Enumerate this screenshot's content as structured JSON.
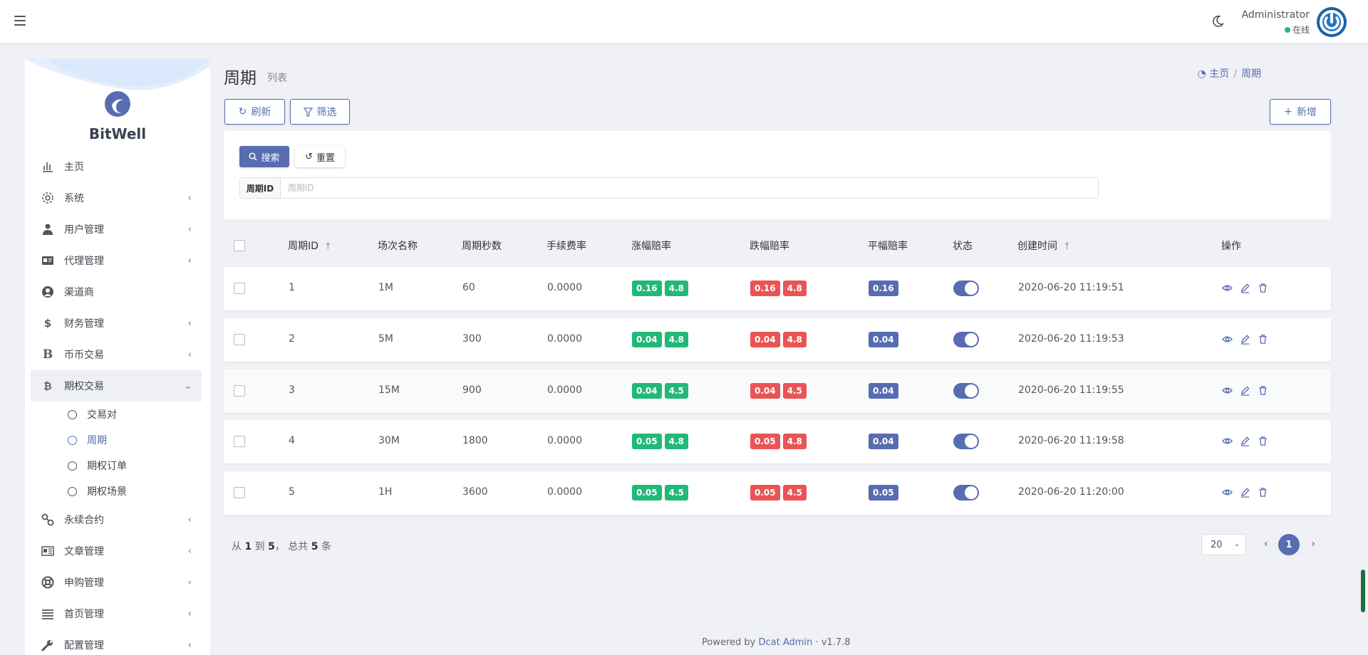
{
  "header": {
    "user_name": "Administrator",
    "user_status": "在线",
    "menu_toggle_icon": "hamburger-icon",
    "theme_icon": "moon-icon",
    "status_color": "#21b978"
  },
  "sidebar": {
    "brand": "BitWell",
    "items": [
      {
        "label": "主页",
        "icon": "bar-chart-icon",
        "chevron": ""
      },
      {
        "label": "系统",
        "icon": "gear-icon",
        "chevron": "‹"
      },
      {
        "label": "用户管理",
        "icon": "user-tie-icon",
        "chevron": "‹"
      },
      {
        "label": "代理管理",
        "icon": "id-card-icon",
        "chevron": "‹"
      },
      {
        "label": "渠道商",
        "icon": "user-circle-icon",
        "chevron": ""
      },
      {
        "label": "财务管理",
        "icon": "dollar-icon",
        "chevron": "‹"
      },
      {
        "label": "币币交易",
        "icon": "bitcoin-b-icon",
        "chevron": "‹"
      },
      {
        "label": "期权交易",
        "icon": "bitcoin-icon",
        "chevron": "⌄"
      }
    ],
    "subitems": [
      {
        "label": "交易对"
      },
      {
        "label": "周期"
      },
      {
        "label": "期权订单"
      },
      {
        "label": "期权场景"
      }
    ],
    "items_after": [
      {
        "label": "永续合约",
        "icon": "link-icon",
        "chevron": "‹"
      },
      {
        "label": "文章管理",
        "icon": "newspaper-icon",
        "chevron": "‹"
      },
      {
        "label": "申购管理",
        "icon": "life-ring-icon",
        "chevron": "‹"
      },
      {
        "label": "首页管理",
        "icon": "list-icon",
        "chevron": "‹"
      },
      {
        "label": "配置管理",
        "icon": "wrench-icon",
        "chevron": "‹"
      }
    ]
  },
  "page": {
    "title": "周期",
    "subtitle": "列表",
    "breadcrumb_home": "主页",
    "breadcrumb_sep": "/",
    "breadcrumb_current": "周期"
  },
  "toolbar": {
    "refresh": "刷新",
    "filter": "筛选",
    "add": "新增"
  },
  "filter": {
    "search": "搜索",
    "reset": "重置",
    "field_label": "周期ID",
    "field_placeholder": "周期ID",
    "field_value": ""
  },
  "table": {
    "columns": [
      "周期ID",
      "场次名称",
      "周期秒数",
      "手续费率",
      "涨幅赔率",
      "跌幅赔率",
      "平幅赔率",
      "状态",
      "创建时间",
      "操作"
    ],
    "rows": [
      {
        "id": "1",
        "name": "1M",
        "seconds": "60",
        "fee": "0.0000",
        "up": [
          "0.16",
          "4.8"
        ],
        "down": [
          "0.16",
          "4.8"
        ],
        "flat": "0.16",
        "status": true,
        "created": "2020-06-20 11:19:51"
      },
      {
        "id": "2",
        "name": "5M",
        "seconds": "300",
        "fee": "0.0000",
        "up": [
          "0.04",
          "4.8"
        ],
        "down": [
          "0.04",
          "4.8"
        ],
        "flat": "0.04",
        "status": true,
        "created": "2020-06-20 11:19:53"
      },
      {
        "id": "3",
        "name": "15M",
        "seconds": "900",
        "fee": "0.0000",
        "up": [
          "0.04",
          "4.5"
        ],
        "down": [
          "0.04",
          "4.5"
        ],
        "flat": "0.04",
        "status": true,
        "created": "2020-06-20 11:19:55"
      },
      {
        "id": "4",
        "name": "30M",
        "seconds": "1800",
        "fee": "0.0000",
        "up": [
          "0.05",
          "4.8"
        ],
        "down": [
          "0.05",
          "4.8"
        ],
        "flat": "0.04",
        "status": true,
        "created": "2020-06-20 11:19:58"
      },
      {
        "id": "5",
        "name": "1H",
        "seconds": "3600",
        "fee": "0.0000",
        "up": [
          "0.05",
          "4.5"
        ],
        "down": [
          "0.05",
          "4.5"
        ],
        "flat": "0.05",
        "status": true,
        "created": "2020-06-20 11:20:00"
      }
    ]
  },
  "pagination": {
    "from_prefix": "从",
    "from": "1",
    "to_word": "到",
    "to": "5",
    "total_prefix": "， 总共",
    "total": "5",
    "total_suffix": "条",
    "per_page": "20",
    "current_page": "1",
    "prev": "‹",
    "next": "›"
  },
  "footer": {
    "powered_by": "Powered by",
    "brand": "Dcat Admin",
    "dot": "·",
    "version": "v1.7.8"
  },
  "colors": {
    "primary": "#586cb1",
    "success": "#21b978",
    "danger": "#ea5455"
  }
}
